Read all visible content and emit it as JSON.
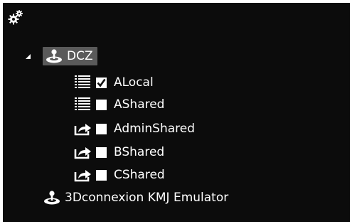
{
  "toolbar": {
    "settings_icon": "gears-icon"
  },
  "tree": {
    "root": {
      "label": "DCZ",
      "icon": "joystick-icon",
      "expanded": true,
      "children": [
        {
          "label": "ALocal",
          "type_icon": "list-icon",
          "checked": true
        },
        {
          "label": "AShared",
          "type_icon": "list-icon",
          "checked": false
        },
        {
          "label": "AdminShared",
          "type_icon": "share-icon",
          "checked": false
        },
        {
          "label": "BShared",
          "type_icon": "share-icon",
          "checked": false
        },
        {
          "label": "CShared",
          "type_icon": "share-icon",
          "checked": false
        }
      ]
    },
    "device": {
      "label": "3Dconnexion KMJ Emulator",
      "icon": "joystick-icon"
    }
  },
  "colors": {
    "background": "#0c0c0c",
    "selection": "#5a5a5a",
    "foreground": "#ffffff"
  }
}
